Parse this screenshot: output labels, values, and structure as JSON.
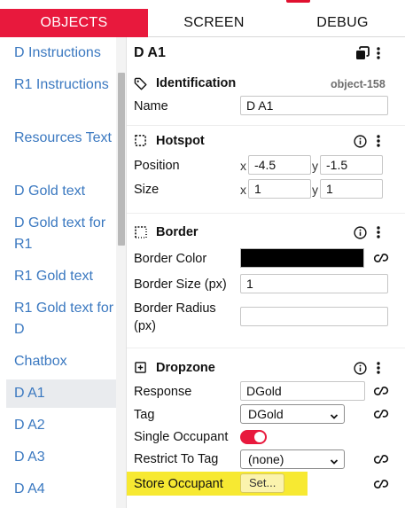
{
  "tabs": [
    {
      "label": "OBJECTS",
      "active": true
    },
    {
      "label": "SCREEN",
      "active": false
    },
    {
      "label": "DEBUG",
      "active": false
    }
  ],
  "sidebar": {
    "items": [
      {
        "label": "D Instructions",
        "active": false
      },
      {
        "label": "R1 Instructions",
        "active": false
      },
      {
        "label": "Resources Text",
        "active": false
      },
      {
        "label": "D Gold text",
        "active": false
      },
      {
        "label": "D Gold text for R1",
        "active": false
      },
      {
        "label": "R1 Gold text",
        "active": false
      },
      {
        "label": "R1 Gold text for D",
        "active": false
      },
      {
        "label": "Chatbox",
        "active": false
      },
      {
        "label": "D A1",
        "active": true
      },
      {
        "label": "D A2",
        "active": false
      },
      {
        "label": "D A3",
        "active": false
      },
      {
        "label": "D A4",
        "active": false
      }
    ]
  },
  "panel": {
    "object_title": "D A1",
    "identification": {
      "heading": "Identification",
      "object_id": "object-158",
      "name_label": "Name",
      "name_value": "D A1"
    },
    "hotspot": {
      "heading": "Hotspot",
      "position_label": "Position",
      "position_x": "-4.5",
      "position_y": "-1.5",
      "size_label": "Size",
      "size_x": "1",
      "size_y": "1",
      "x_label": "x",
      "y_label": "y"
    },
    "border": {
      "heading": "Border",
      "color_label": "Border Color",
      "color_value": "#000000",
      "size_label": "Border Size (px)",
      "size_value": "1",
      "radius_label_1": "Border Radius",
      "radius_label_2": "(px)",
      "radius_value": ""
    },
    "dropzone": {
      "heading": "Dropzone",
      "response_label": "Response",
      "response_value": "DGold",
      "tag_label": "Tag",
      "tag_value": "DGold",
      "single_occupant_label": "Single Occupant",
      "single_occupant_on": true,
      "restrict_label": "Restrict To Tag",
      "restrict_value": "(none)",
      "store_label": "Store Occupant",
      "store_button": "Set..."
    }
  },
  "colors": {
    "accent": "#e8193d",
    "link": "#3a78c0",
    "highlight": "#f7e932"
  }
}
